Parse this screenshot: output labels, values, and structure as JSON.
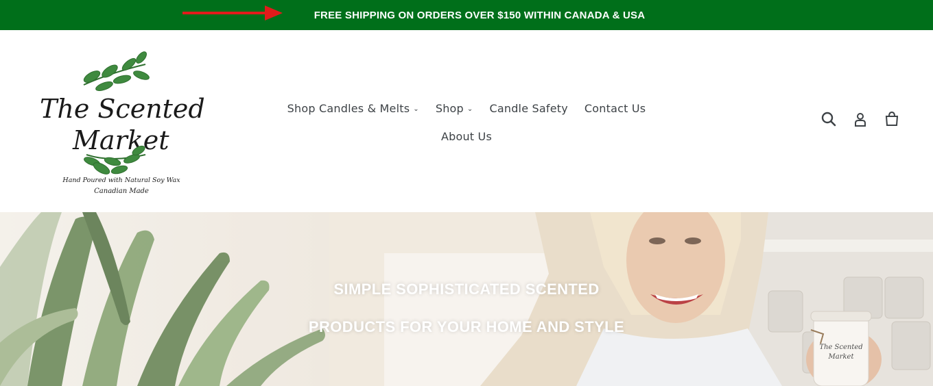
{
  "announcement": {
    "text": "FREE SHIPPING ON ORDERS OVER $150 WITHIN CANADA & USA",
    "background": "#006f1a",
    "arrow_color": "#e01b1b"
  },
  "logo": {
    "line1": "The Scented",
    "line2": "Market",
    "tagline1": "Hand Poured with Natural Soy Wax",
    "tagline2": "Canadian Made"
  },
  "nav": {
    "items": [
      {
        "label": "Shop Candles & Melts",
        "has_dropdown": true
      },
      {
        "label": "Shop",
        "has_dropdown": true
      },
      {
        "label": "Candle Safety",
        "has_dropdown": false
      },
      {
        "label": "Contact Us",
        "has_dropdown": false
      },
      {
        "label": "About Us",
        "has_dropdown": false
      }
    ],
    "caret": "⌄"
  },
  "header_icons": [
    "search-icon",
    "account-icon",
    "cart-icon"
  ],
  "hero": {
    "line1": "SIMPLE SOPHISTICATED SCENTED",
    "line2": "PRODUCTS FOR YOUR HOME AND STYLE",
    "jar_label1": "The Scented",
    "jar_label2": "Market"
  }
}
